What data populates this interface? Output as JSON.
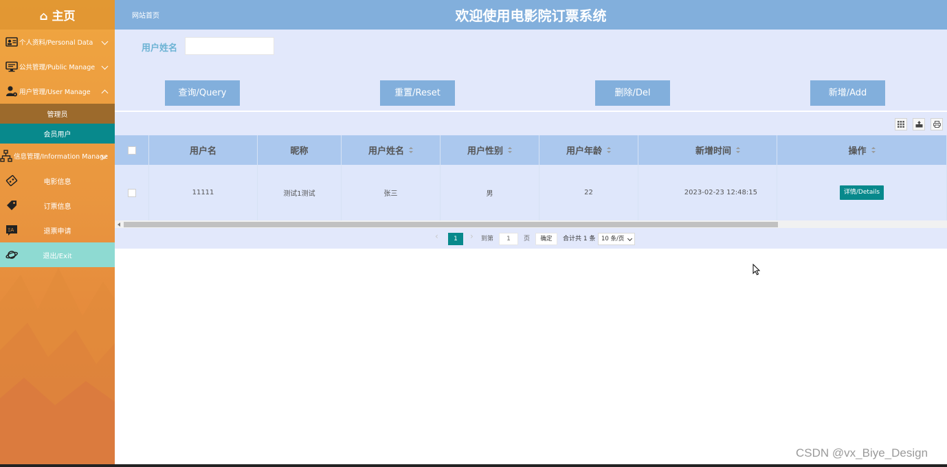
{
  "sidebar": {
    "home": "⌂ 主页",
    "groups": [
      {
        "label": "个人资料/Personal Data",
        "icon": "id-card-icon"
      },
      {
        "label": "公共管理/Public Manage",
        "icon": "monitor-icon"
      },
      {
        "label": "用户管理/User Manage",
        "icon": "user-gear-icon"
      }
    ],
    "user_sub": [
      "管理员",
      "会员用户"
    ],
    "info_group": {
      "label": "信息管理/Information Manage",
      "icon": "sitemap-icon"
    },
    "info_items": [
      {
        "label": "电影信息",
        "icon": "film-icon"
      },
      {
        "label": "订票信息",
        "icon": "ticket-tag-icon"
      },
      {
        "label": "退票申请",
        "icon": "translate-icon"
      }
    ],
    "exit": {
      "label": "退出/Exit",
      "icon": "planet-icon"
    }
  },
  "header": {
    "breadcrumb": "网站首页",
    "title": "欢迎使用电影院订票系统"
  },
  "search": {
    "label": "用户姓名",
    "value": "",
    "buttons": {
      "query": "查询/Query",
      "reset": "重置/Reset",
      "del": "删除/Del",
      "add": "新增/Add"
    }
  },
  "table": {
    "columns": [
      "用户名",
      "昵称",
      "用户姓名",
      "用户性别",
      "用户年龄",
      "新增时间",
      "操作"
    ],
    "rows": [
      {
        "username": "11111",
        "nickname": "测试1测试",
        "realname": "张三",
        "gender": "男",
        "age": "22",
        "created": "2023-02-23 12:48:15",
        "action": "详情/Details"
      }
    ]
  },
  "pager": {
    "current": "1",
    "goto_label": "到第",
    "goto_value": "1",
    "page_unit": "页",
    "confirm": "确定",
    "total": "合计共 1 条",
    "page_size": "10 条/页"
  },
  "watermark": "CSDN @vx_Biye_Design",
  "colors": {
    "accent": "#08898c",
    "header": "#82afdc",
    "panel": "#e2e8fb",
    "sidebar": "#e9953f"
  }
}
